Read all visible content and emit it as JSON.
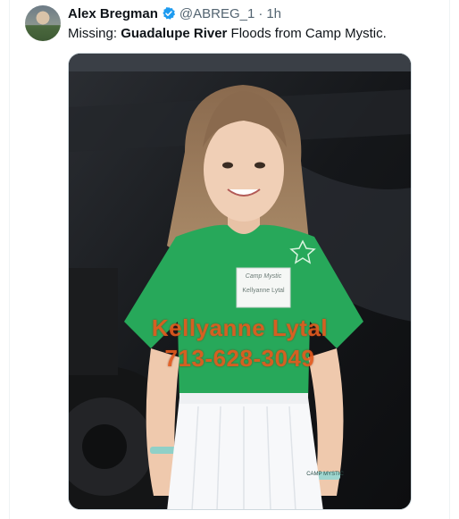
{
  "post": {
    "author_name": "Alex Bregman",
    "handle": "@ABREG_1",
    "separator": "·",
    "time": "1h",
    "text_prefix": "Missing: ",
    "text_bold": "Guadalupe River",
    "text_suffix": " Floods from Camp Mystic."
  },
  "media": {
    "overlay_name": "Kellyanne Lytal",
    "overlay_phone": "713-628-3049",
    "name_tag_script": "Camp Mystic",
    "name_tag_name": "Kellyanne Lytal",
    "bracelet_text": "CAMP MYSTIC"
  },
  "colors": {
    "verified": "#1d9bf0",
    "overlay_text": "#e35a1e",
    "shirt": "#27a85a"
  }
}
